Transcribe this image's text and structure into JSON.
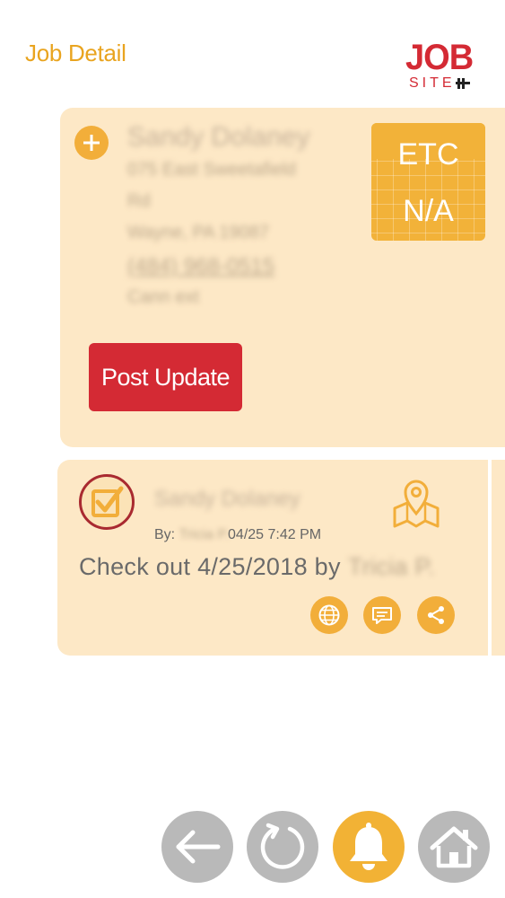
{
  "header": {
    "title": "Job Detail",
    "logo_job": "JOB",
    "logo_site": "SITE"
  },
  "job_card": {
    "customer_name": "Sandy Dolaney",
    "address_line1": "075 East Sweetafield",
    "address_line2": "Rd",
    "address_line3": "Wayne, PA 19087",
    "phone": "(484) 968-0515",
    "note": "Cann ext",
    "etc_label": "ETC",
    "etc_value": "N/A",
    "post_update_label": "Post Update"
  },
  "activity_card": {
    "customer_name": "Sandy Dolaney",
    "by_label": "By:",
    "by_user": "Tricia P.",
    "timestamp": "04/25 7:42 PM",
    "checkout_text": "Check out 4/25/2018 by",
    "checkout_user": "Tricia P."
  },
  "icons": {
    "add": "plus-icon",
    "checked": "checkbox-checked-icon",
    "map": "map-pin-icon",
    "web": "globe-icon",
    "comment": "comment-icon",
    "share": "share-icon",
    "back": "arrow-left-icon",
    "refresh": "refresh-icon",
    "notifications": "bell-icon",
    "home": "home-icon"
  },
  "colors": {
    "accent": "#f2ae3a",
    "brand_red": "#d42a34",
    "card_bg": "#fde8c6",
    "nav_grey": "#b9b9b9"
  }
}
